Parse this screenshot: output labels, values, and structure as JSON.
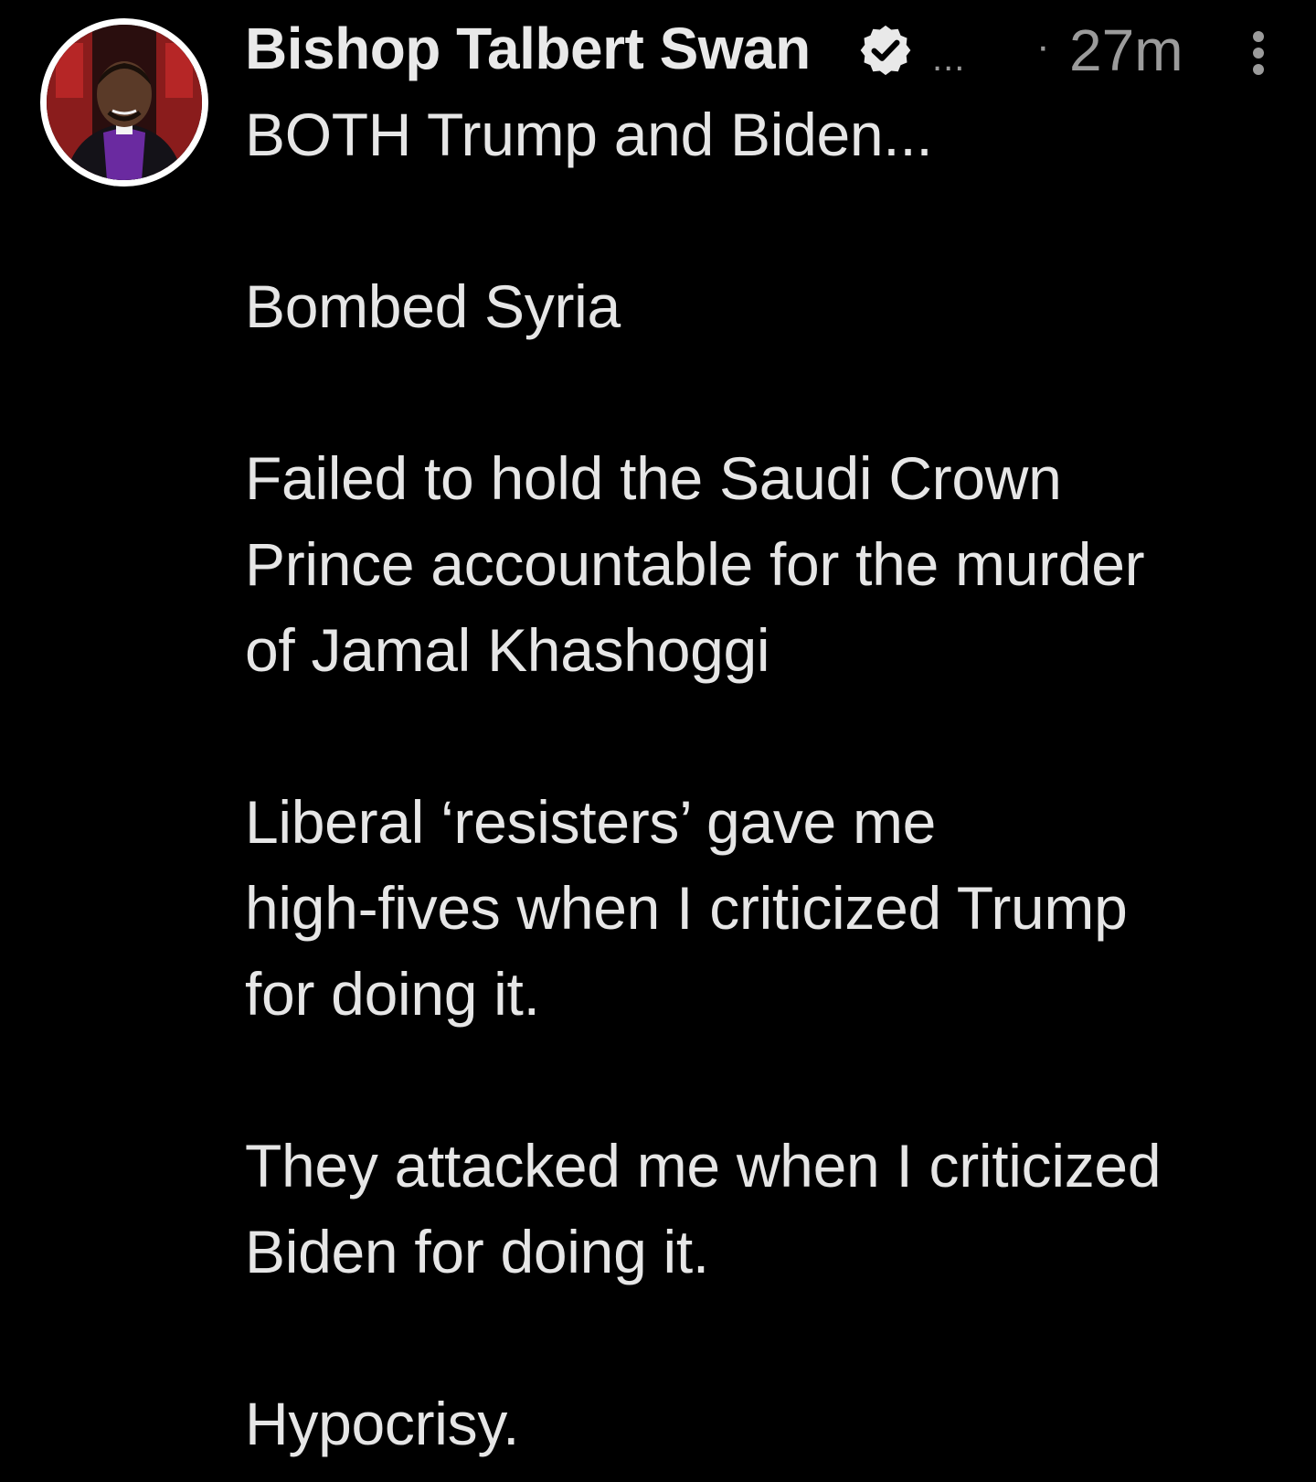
{
  "author": {
    "display_name": "Bishop Talbert Swan",
    "truncation": "...",
    "separator": "·",
    "timestamp": "27m",
    "verified": true,
    "avatar_icon": "profile-photo"
  },
  "tweet": {
    "paragraphs": [
      "BOTH  Trump and Biden...",
      "Bombed Syria",
      "Failed to hold the Saudi Crown\nPrince accountable for the murder\nof Jamal Khashoggi",
      "Liberal ‘resisters’ gave me\nhigh-fives when I criticized Trump\nfor doing it.",
      "They attacked me when I criticized\nBiden for doing it.",
      "Hypocrisy."
    ]
  },
  "colors": {
    "background": "#000000",
    "text": "#e6e6e6",
    "muted": "#9b9b9b"
  }
}
